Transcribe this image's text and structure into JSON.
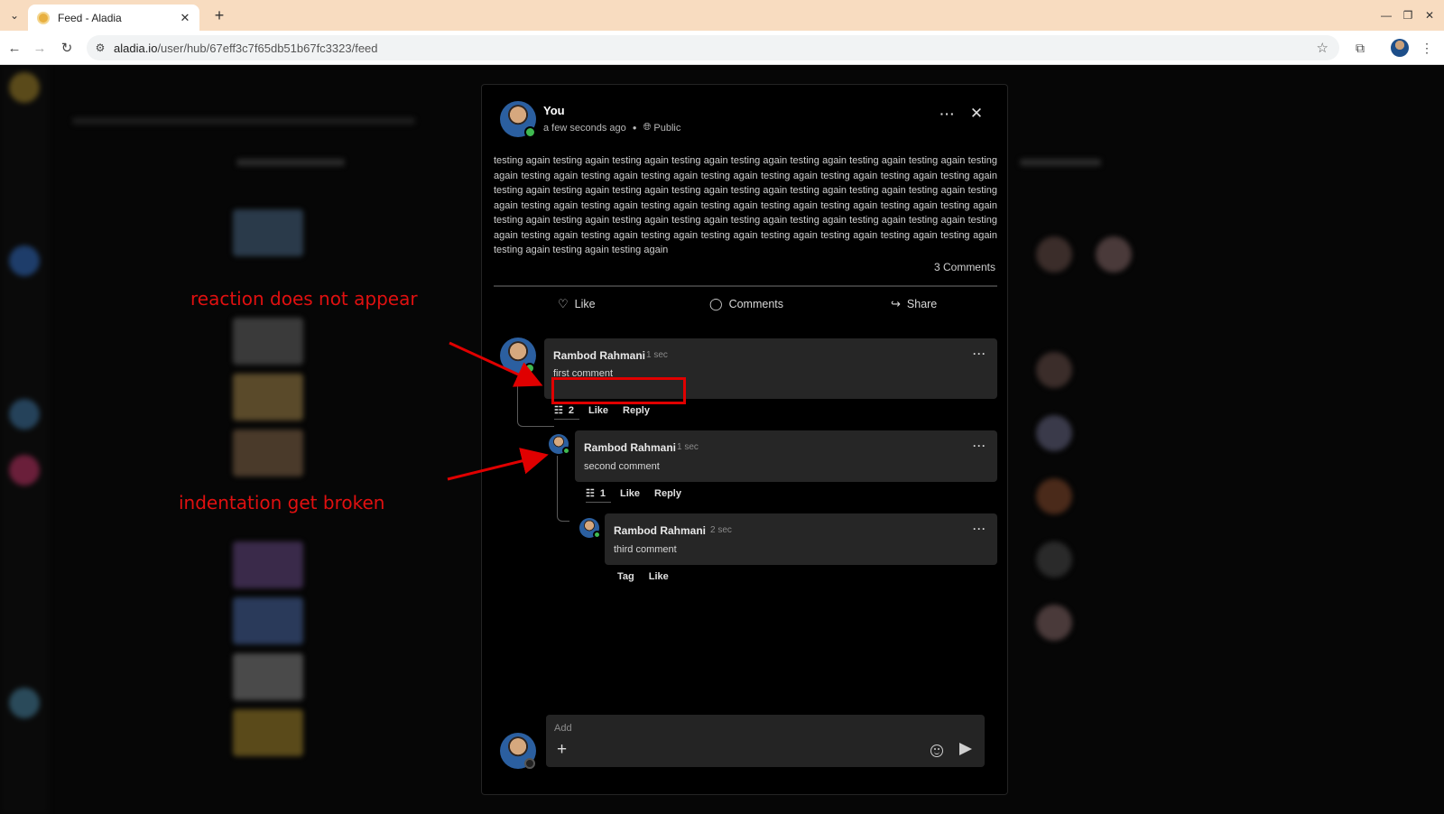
{
  "browser": {
    "tab_title": "Feed - Aladia",
    "url_host": "aladia.io",
    "url_path": "/user/hub/67eff3c7f65db51b67fc3323/feed"
  },
  "post": {
    "author": "You",
    "time": "a few seconds ago",
    "visibility": "Public",
    "body": "testing again testing again testing again testing again testing again testing again testing again testing again testing again testing again testing again testing again testing again testing again testing again testing again testing again testing again testing again testing again testing again testing again testing again testing again testing again testing again testing again testing again testing again testing again testing again testing again testing again testing again testing again testing again testing again testing again testing again testing again testing again testing again testing again testing again testing again testing again testing again testing again testing again testing again testing again testing again testing again testing again",
    "comment_count": "3 Comments",
    "actions": {
      "like": "Like",
      "comments": "Comments",
      "share": "Share"
    }
  },
  "comments": [
    {
      "name": "Rambod Rahmani",
      "time": "1 sec",
      "text": "first comment",
      "replies": "2",
      "like": "Like",
      "reply": "Reply"
    },
    {
      "name": "Rambod Rahmani",
      "time": "1 sec",
      "text": "second comment",
      "replies": "1",
      "like": "Like",
      "reply": "Reply"
    },
    {
      "name": "Rambod Rahmani",
      "time": "2 sec",
      "text": "third comment",
      "tag": "Tag",
      "like": "Like"
    }
  ],
  "composer": {
    "placeholder": "Add"
  },
  "annotations": {
    "reaction": "reaction does not appear",
    "indentation": "indentation get broken",
    "color": "#e01010"
  }
}
